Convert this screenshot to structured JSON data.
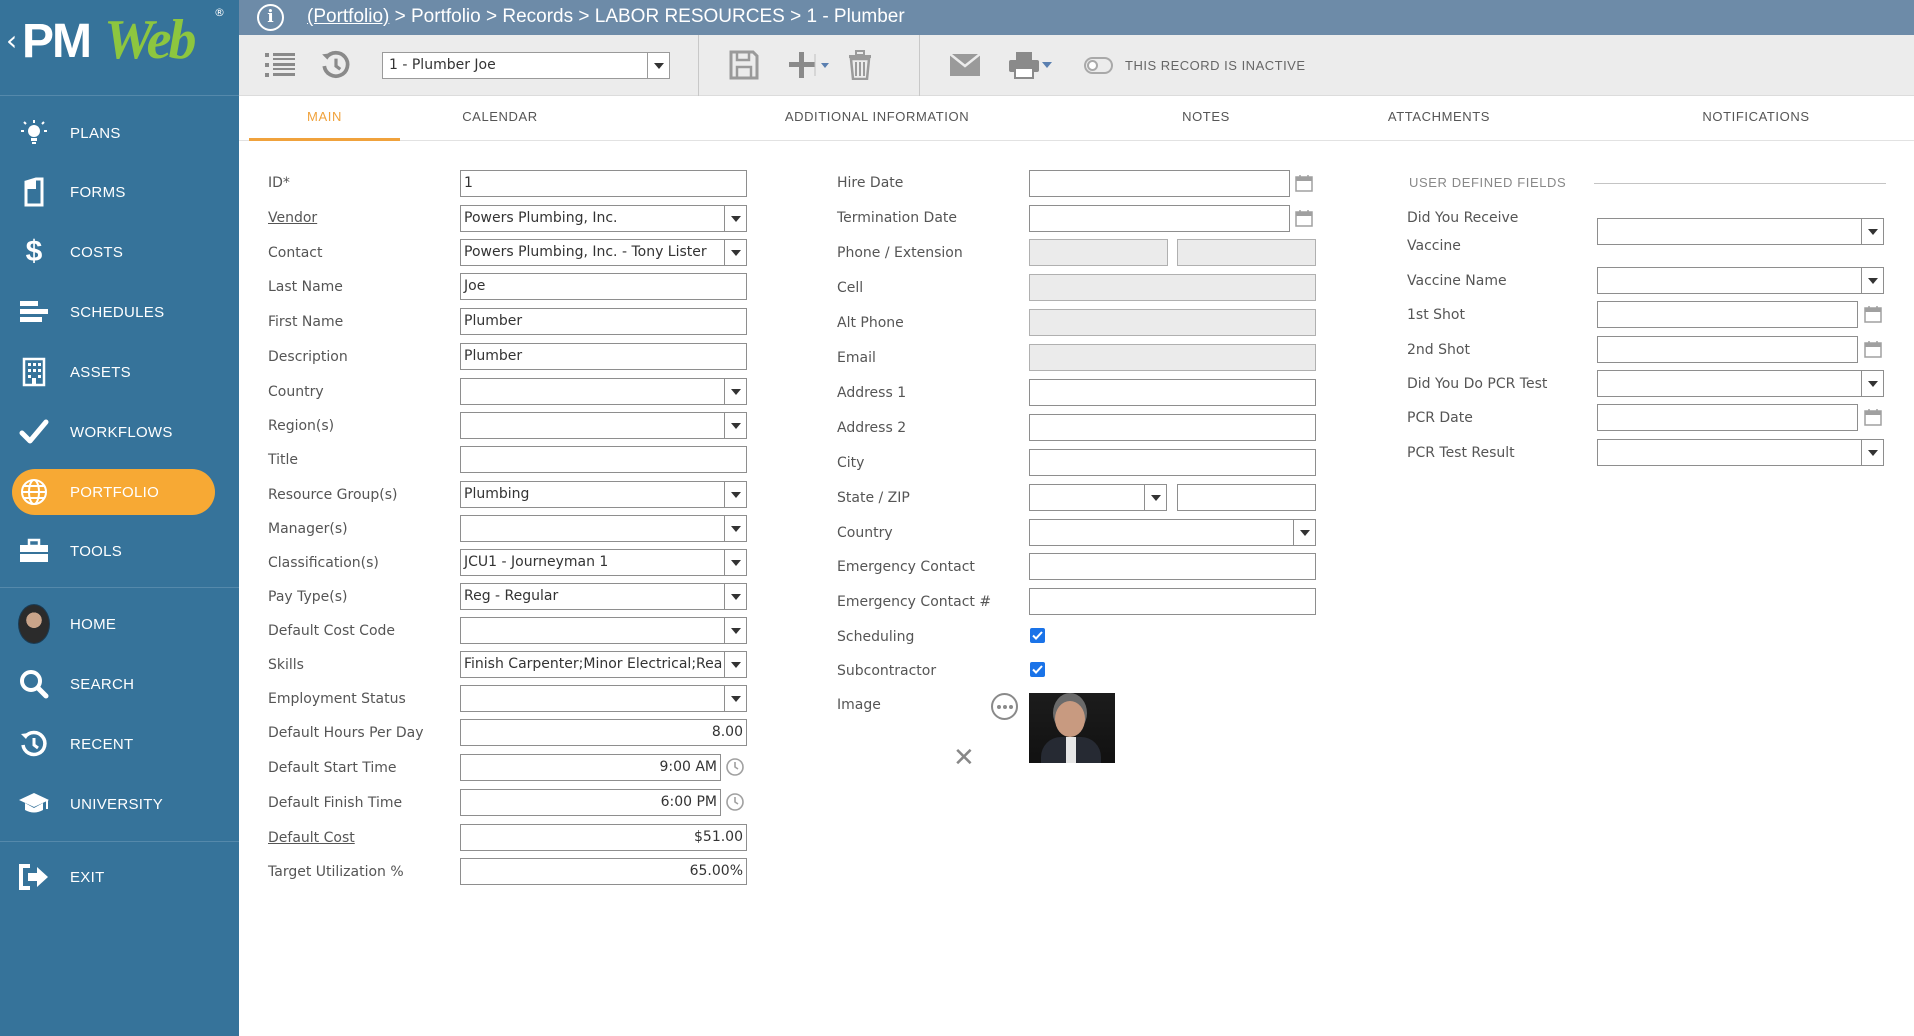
{
  "app": {
    "logo_text_pm": "PM",
    "logo_text_web": "Web",
    "logo_mark": "®"
  },
  "sidebar": {
    "items": [
      {
        "label": "PLANS",
        "icon": "lightbulb-icon"
      },
      {
        "label": "FORMS",
        "icon": "document-icon"
      },
      {
        "label": "COSTS",
        "icon": "dollar-icon"
      },
      {
        "label": "SCHEDULES",
        "icon": "gantt-icon"
      },
      {
        "label": "ASSETS",
        "icon": "building-icon"
      },
      {
        "label": "WORKFLOWS",
        "icon": "checkmark-icon"
      },
      {
        "label": "PORTFOLIO",
        "icon": "globe-icon",
        "active": true
      },
      {
        "label": "TOOLS",
        "icon": "toolbox-icon"
      },
      {
        "label": "HOME",
        "icon": "avatar"
      },
      {
        "label": "SEARCH",
        "icon": "search-icon"
      },
      {
        "label": "RECENT",
        "icon": "history-icon"
      },
      {
        "label": "UNIVERSITY",
        "icon": "graduation-cap-icon"
      },
      {
        "label": "EXIT",
        "icon": "exit-icon"
      }
    ],
    "accent_color": "#f7a934",
    "background_color": "#36739a"
  },
  "header": {
    "breadcrumb_link": "(Portfolio)",
    "breadcrumb_rest": " > Portfolio > Records > LABOR RESOURCES > 1 - Plumber"
  },
  "toolbar": {
    "record_selector_value": "1 - Plumber Joe",
    "inactive_label": "THIS RECORD IS INACTIVE",
    "inactive_toggle_on": false
  },
  "tabs": [
    {
      "label": "MAIN",
      "active": true
    },
    {
      "label": "CALENDAR"
    },
    {
      "label": "ADDITIONAL INFORMATION"
    },
    {
      "label": "NOTES"
    },
    {
      "label": "ATTACHMENTS"
    },
    {
      "label": "NOTIFICATIONS"
    }
  ],
  "form_left": {
    "id": {
      "label": "ID*",
      "value": "1"
    },
    "vendor": {
      "label": "Vendor",
      "value": "Powers Plumbing, Inc."
    },
    "contact": {
      "label": "Contact",
      "value": "Powers Plumbing, Inc. - Tony Lister"
    },
    "last_name": {
      "label": "Last Name",
      "value": "Joe"
    },
    "first_name": {
      "label": "First Name",
      "value": "Plumber"
    },
    "description": {
      "label": "Description",
      "value": "Plumber"
    },
    "country": {
      "label": "Country",
      "value": ""
    },
    "regions": {
      "label": "Region(s)",
      "value": ""
    },
    "title": {
      "label": "Title",
      "value": ""
    },
    "resource_groups": {
      "label": "Resource Group(s)",
      "value": "Plumbing"
    },
    "managers": {
      "label": "Manager(s)",
      "value": ""
    },
    "classifications": {
      "label": "Classification(s)",
      "value": "JCU1 - Journeyman 1"
    },
    "pay_types": {
      "label": "Pay Type(s)",
      "value": "Reg - Regular"
    },
    "default_cost_code": {
      "label": "Default Cost Code",
      "value": ""
    },
    "skills": {
      "label": "Skills",
      "value": "Finish Carpenter;Minor Electrical;Rea"
    },
    "employment_status": {
      "label": "Employment Status",
      "value": ""
    },
    "default_hours": {
      "label": "Default Hours Per Day",
      "value": "8.00"
    },
    "default_start": {
      "label": "Default Start Time",
      "value": "9:00 AM"
    },
    "default_finish": {
      "label": "Default Finish Time",
      "value": "6:00 PM"
    },
    "default_cost": {
      "label": "Default Cost",
      "value": "$51.00"
    },
    "target_util": {
      "label": "Target Utilization %",
      "value": "65.00%"
    }
  },
  "form_middle": {
    "hire_date": {
      "label": "Hire Date",
      "value": ""
    },
    "termination_date": {
      "label": "Termination Date",
      "value": ""
    },
    "phone": {
      "label": "Phone / Extension",
      "value": "",
      "extension": ""
    },
    "cell": {
      "label": "Cell",
      "value": ""
    },
    "alt_phone": {
      "label": "Alt Phone",
      "value": ""
    },
    "email": {
      "label": "Email",
      "value": ""
    },
    "address1": {
      "label": "Address 1",
      "value": ""
    },
    "address2": {
      "label": "Address 2",
      "value": ""
    },
    "city": {
      "label": "City",
      "value": ""
    },
    "state_zip": {
      "label": "State / ZIP",
      "state": "",
      "zip": ""
    },
    "country": {
      "label": "Country",
      "value": ""
    },
    "emergency_contact": {
      "label": "Emergency Contact",
      "value": ""
    },
    "emergency_contact_no": {
      "label": "Emergency Contact #",
      "value": ""
    },
    "scheduling": {
      "label": "Scheduling",
      "checked": true
    },
    "subcontractor": {
      "label": "Subcontractor",
      "checked": true
    },
    "image": {
      "label": "Image"
    }
  },
  "user_defined": {
    "section_title": "USER DEFINED FIELDS",
    "received_vaccine_line1": "Did You Receive",
    "received_vaccine_line2": "Vaccine",
    "received_vaccine_value": "",
    "vaccine_name": {
      "label": "Vaccine Name",
      "value": ""
    },
    "first_shot": {
      "label": "1st Shot",
      "value": ""
    },
    "second_shot": {
      "label": "2nd Shot",
      "value": ""
    },
    "pcr_test": {
      "label": "Did You Do PCR Test",
      "value": ""
    },
    "pcr_date": {
      "label": "PCR Date",
      "value": ""
    },
    "pcr_result": {
      "label": "PCR Test Result",
      "value": ""
    }
  }
}
